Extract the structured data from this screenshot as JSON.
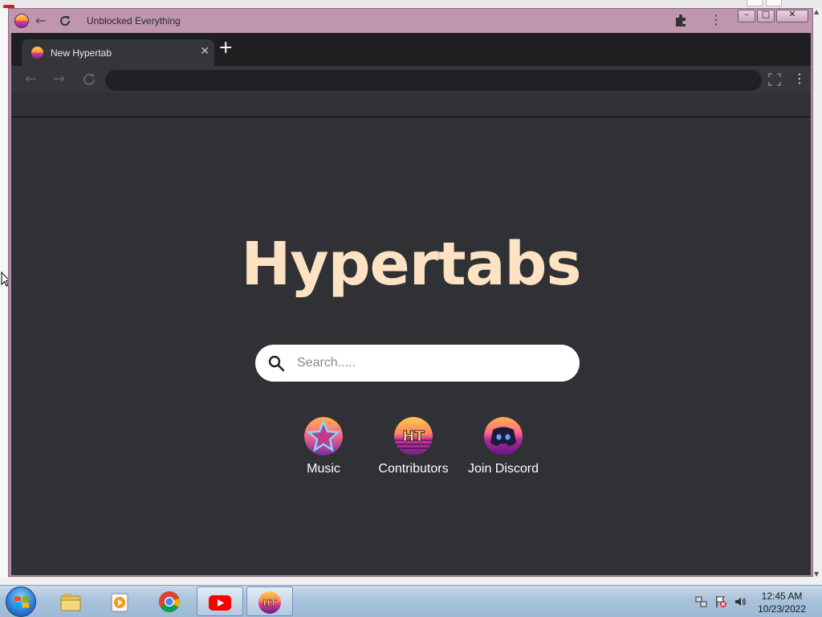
{
  "browser": {
    "window_title": "Unblocked Everything",
    "tab_title": "New Hypertab",
    "address": ""
  },
  "page": {
    "logo": "Hypertabs",
    "search_placeholder": "Search.....",
    "shortcuts": [
      {
        "label": "Music",
        "icon": "star-icon"
      },
      {
        "label": "Contributors",
        "icon": "ht-logo-icon"
      },
      {
        "label": "Join Discord",
        "icon": "discord-icon"
      }
    ]
  },
  "taskbar": {
    "time": "12:45 AM",
    "date": "10/23/2022",
    "apps": [
      "file-explorer",
      "media-player",
      "chrome",
      "youtube",
      "hypertabs"
    ]
  },
  "colors": {
    "title_bar": "#bf95b0",
    "page_bg": "#303134",
    "logo_text": "#fde3c4"
  }
}
